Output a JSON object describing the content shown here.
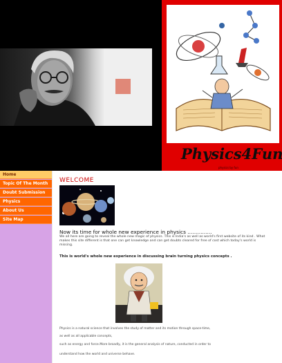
{
  "site": {
    "brand": "Physics4Fun",
    "brand_credit": "physics by fun"
  },
  "nav": [
    {
      "label": "Home",
      "active": true
    },
    {
      "label": "Topic Of The Month",
      "active": false
    },
    {
      "label": "Doubt Submission",
      "active": false
    },
    {
      "label": "Physics",
      "active": false
    },
    {
      "label": "About Us",
      "active": false
    },
    {
      "label": "Site Map",
      "active": false
    }
  ],
  "content": {
    "welcome": "WELCOME",
    "headline": "Now its time for whole new experience in physics ...............",
    "intro": "We all here are going to reveal the whole new magic of physics. This is India's as well as world's first website of its kind . What makes this site different is that one can get knowledge and can get doubts cleared for free of cost which today's world is missing.",
    "highlight": "This is world's whole new experience in discussing brain turning physics concepts .",
    "definition": [
      "Physics is a natural science that involves the study of matter and its motion through space-time,",
      "as well as all applicable concepts,",
      "such as energy and force.More broadly, it is the general analysis of nature, conducted in order to",
      "understand how the world and universe behave."
    ]
  },
  "colors": {
    "header_red": "#e00000",
    "nav_orange": "#ff6600",
    "nav_active": "#ffcc66",
    "sidebar_lavender": "#d7a3e6",
    "welcome_red": "#cc0000"
  },
  "icons": {
    "portrait": "scientist-portrait-image",
    "science": "science-illustration-image",
    "planets": "planets-image",
    "einstein": "einstein-caricature-image"
  }
}
